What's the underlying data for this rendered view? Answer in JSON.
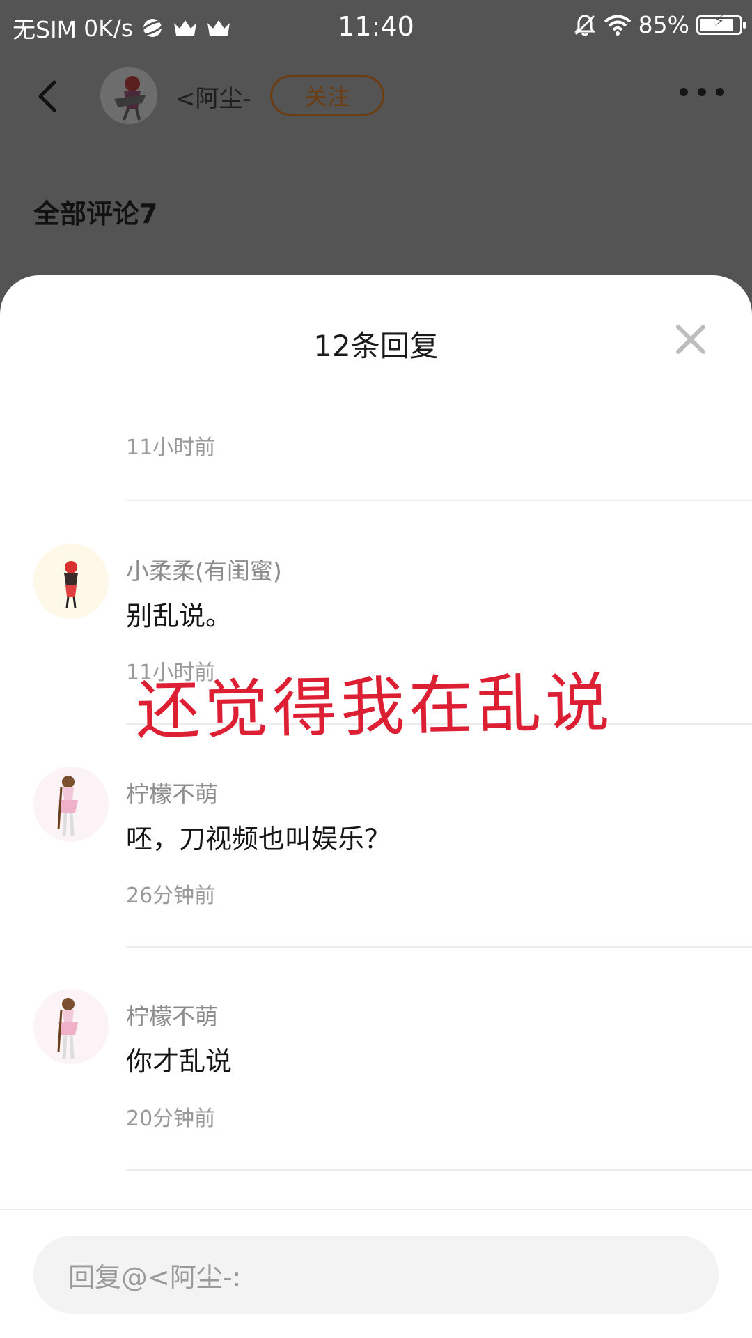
{
  "status_bar": {
    "carrier": "无SIM",
    "speed": "0K/s",
    "time": "11:40",
    "battery": "85%",
    "battery_level": 0.85
  },
  "header": {
    "username": "<阿尘-",
    "follow_label": "关注"
  },
  "section_title": "全部评论7",
  "sheet": {
    "title": "12条回复",
    "replies": [
      {
        "name": "",
        "text": "",
        "time": "11小时前"
      },
      {
        "name": "小柔柔(有闺蜜)",
        "text": "别乱说。",
        "time": "11小时前"
      },
      {
        "name": "柠檬不萌",
        "text": "呸，刀视频也叫娱乐？",
        "time": "26分钟前"
      },
      {
        "name": "柠檬不萌",
        "text": "你才乱说",
        "time": "20分钟前"
      }
    ],
    "overlay_text": "还觉得我在乱说"
  },
  "input": {
    "placeholder": "回复@<阿尘-:"
  },
  "colors": {
    "overlay_red": "#dc1f33",
    "follow_brown": "#6b3d12",
    "dim_bg": "#545454"
  }
}
